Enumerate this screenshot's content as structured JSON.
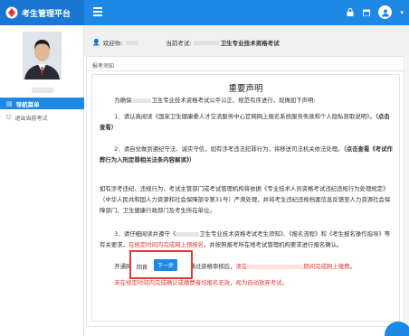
{
  "app": {
    "title": "考生管理平台",
    "avatar_text": "●"
  },
  "topbar": {
    "icons": [
      "hamburger-icon",
      "lock-icon",
      "calendar-icon",
      "avatar-icon",
      "chevron-down-icon"
    ]
  },
  "sidebar": {
    "nav_header": "导航菜单",
    "items": [
      {
        "label": "退出当前考试",
        "icon": "exit-icon"
      }
    ]
  },
  "infobar": {
    "welcome_label": "欢迎你:",
    "current_exam_label": "当前考试:",
    "current_exam_name": "卫生专业技术资格考试"
  },
  "panel": {
    "title": "报考须知"
  },
  "notice": {
    "heading": "重要声明",
    "p1_a": "为确保",
    "p1_b": "卫生专业技术资格考试公平公正、规范有序进行，现做如下声明:",
    "p2_a": "1．请认真阅读《国家卫生健康委人才交流服务中心官网网上报名系统服务条款和个人隐私获取说明》。",
    "p2_link": "（点击查看）",
    "p3_a": "2．请自觉做到遵纪守法、诚实守信，如有涉考违法犯罪行为，将移送司法机关依法处理。",
    "p3_link": "（点击查看《考试作弊行为入刑定罪相关法条内容解读》）",
    "p4": "如有涉考违纪、违规行为，考试主管部门或考试管理机构将依据《专业技术人员资格考试违纪违规行为处理规定》（中华人民共和国人力资源和社会保障部令第31号）严肃处理，并将考生违纪违规档案信息反馈至人力资源社会保障部门、卫生健康行政部门及考生所在单位。",
    "p5_a": "3．请仔细阅读并遵守《",
    "p5_b": "卫生专业技术资格考试考生须知》、《报名流程》和《考生报名操作指导》等有关要求，",
    "p5_red": "在规定时间内完成网上预报名",
    "p5_c": "，并按照报考所在地考试管理机构要求进行报名确认。",
    "p6_a": "开通网上缴费的考区，考生在通过资格审核后，",
    "p6_red_a": "须在",
    "p6_red_b": "期间完成网上缴费",
    "p6_end": "。",
    "p7": "未在规定时间内完成确认或缴费者均报名无效，视为自动放弃考试。"
  },
  "buttons": {
    "back": "回首",
    "next": "下一步"
  },
  "colors": {
    "brand": "#1e88e5",
    "alert": "#e53935"
  }
}
